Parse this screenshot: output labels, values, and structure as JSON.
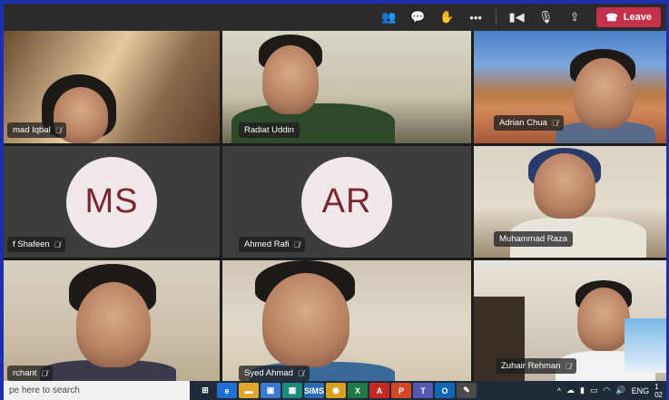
{
  "colors": {
    "leave": "#c4314b",
    "avatar_text": "#7a2633",
    "avatar_bg": "#f1e9e9",
    "taskbar": "#1f2a3a"
  },
  "toolbar": {
    "buttons": [
      {
        "name": "people-icon",
        "glyph": "👥"
      },
      {
        "name": "chat-icon",
        "glyph": "💬"
      },
      {
        "name": "raise-hand-icon",
        "glyph": "✋"
      },
      {
        "name": "more-options-icon",
        "glyph": "•••"
      }
    ],
    "media": [
      {
        "name": "camera-icon",
        "glyph": "▮◀"
      },
      {
        "name": "microphone-icon",
        "glyph": "🎙"
      },
      {
        "name": "share-screen-icon",
        "glyph": "⇪"
      }
    ],
    "leave_label": "Leave",
    "leave_glyph": "☎"
  },
  "participants": [
    {
      "name": "mad Iqbal",
      "type": "video"
    },
    {
      "name": "Radiat Uddin",
      "type": "video"
    },
    {
      "name": "Adrian Chua",
      "type": "video"
    },
    {
      "name": "f Shafeen",
      "type": "avatar",
      "initials": "MS"
    },
    {
      "name": "Ahmed Rafi",
      "type": "avatar",
      "initials": "AR"
    },
    {
      "name": "Muhammad Raza",
      "type": "video"
    },
    {
      "name": "rchant",
      "type": "video"
    },
    {
      "name": "Syed Ahmad",
      "type": "video"
    },
    {
      "name": "Zuhair Rehman",
      "type": "video"
    }
  ],
  "mic_muted_glyph": "🎙̸",
  "taskbar": {
    "search_placeholder": "pe here to search",
    "apps": [
      {
        "name": "task-view-icon",
        "label": "⊞",
        "color": "#1f2a3a"
      },
      {
        "name": "edge-icon",
        "label": "e",
        "color": "#1e6fd0"
      },
      {
        "name": "file-explorer-icon",
        "label": "▬",
        "color": "#e0a82a"
      },
      {
        "name": "store-icon",
        "label": "▣",
        "color": "#3a7ad0"
      },
      {
        "name": "app-icon-1",
        "label": "▦",
        "color": "#1a8a7a"
      },
      {
        "name": "sims-icon",
        "label": "SIMS",
        "color": "#2a6ab0"
      },
      {
        "name": "chrome-icon",
        "label": "◉",
        "color": "#d9a020"
      },
      {
        "name": "excel-icon",
        "label": "X",
        "color": "#1d7a45"
      },
      {
        "name": "acrobat-icon",
        "label": "A",
        "color": "#c62828"
      },
      {
        "name": "powerpoint-icon",
        "label": "P",
        "color": "#d24726"
      },
      {
        "name": "teams-icon",
        "label": "T",
        "color": "#5558af"
      },
      {
        "name": "outlook-icon",
        "label": "O",
        "color": "#0f64b4"
      },
      {
        "name": "paint-icon",
        "label": "✎",
        "color": "#4a4a4a"
      }
    ],
    "tray": {
      "chevron": "^",
      "language": "ENG",
      "clock_top": "1",
      "clock_bottom": "02"
    }
  }
}
